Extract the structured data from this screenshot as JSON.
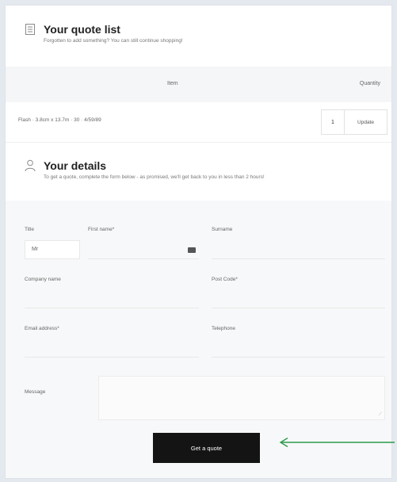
{
  "quote_list": {
    "title": "Your quote list",
    "subtitle": "Forgotten to add something? You can still continue shopping!",
    "table": {
      "col_item": "Item",
      "col_quantity": "Quantity",
      "rows": [
        {
          "product": "Flash · 3.8cm x 13.7m · 30 · 4/59/89",
          "quantity": "1",
          "update_label": "Update"
        }
      ]
    }
  },
  "details": {
    "title": "Your details",
    "subtitle": "To get a quote, complete the form below - as promised, we'll get back to you in less than 2 hours!",
    "fields": {
      "title_label": "Title",
      "title_value": "Mr",
      "first_name_label": "First name*",
      "surname_label": "Surname",
      "company_label": "Company name",
      "postcode_label": "Post Code*",
      "email_label": "Email address*",
      "telephone_label": "Telephone",
      "message_label": "Message"
    },
    "submit_label": "Get a quote"
  },
  "colors": {
    "page_bg": "#e3e9ee",
    "button": "#141414",
    "arrow": "#2e9a4a"
  }
}
